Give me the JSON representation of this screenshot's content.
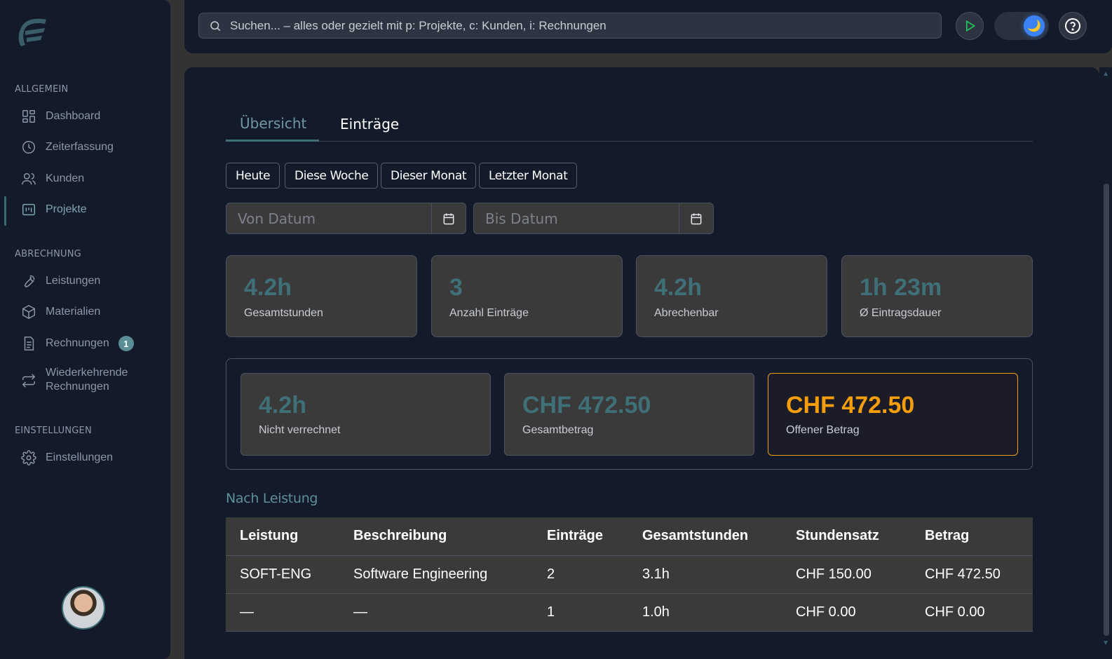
{
  "sidebar": {
    "sections": [
      {
        "title": "ALLGEMEIN"
      },
      {
        "title": "ABRECHNUNG"
      },
      {
        "title": "EINSTELLUNGEN"
      }
    ],
    "items": [
      {
        "label": "Dashboard",
        "icon": "dashboard-icon"
      },
      {
        "label": "Zeiterfassung",
        "icon": "clock-icon"
      },
      {
        "label": "Kunden",
        "icon": "users-icon"
      },
      {
        "label": "Projekte",
        "icon": "project-icon",
        "active": true
      },
      {
        "label": "Leistungen",
        "icon": "wrench-icon"
      },
      {
        "label": "Materialien",
        "icon": "box-icon"
      },
      {
        "label": "Rechnungen",
        "icon": "invoice-icon",
        "badge": "1"
      },
      {
        "label": "Wiederkehrende Rechnungen",
        "icon": "repeat-icon"
      },
      {
        "label": "Einstellungen",
        "icon": "gear-icon"
      }
    ]
  },
  "topbar": {
    "search_placeholder": "Suchen... – alles oder gezielt mit p: Projekte, c: Kunden, i: Rechnungen",
    "theme_icon": "🌙"
  },
  "tabs": [
    {
      "label": "Übersicht",
      "active": true
    },
    {
      "label": "Einträge",
      "active": false
    }
  ],
  "filters": [
    "Heute",
    "Diese Woche",
    "Dieser Monat",
    "Letzter Monat"
  ],
  "date_range": {
    "from_placeholder": "Von Datum",
    "to_placeholder": "Bis Datum"
  },
  "stats": [
    {
      "value": "4.2h",
      "label": "Gesamtstunden"
    },
    {
      "value": "3",
      "label": "Anzahl Einträge"
    },
    {
      "value": "4.2h",
      "label": "Abrechenbar"
    },
    {
      "value": "1h 23m",
      "label": "Ø Eintragsdauer"
    }
  ],
  "money": [
    {
      "value": "4.2h",
      "label": "Nicht verrechnet"
    },
    {
      "value": "CHF 472.50",
      "label": "Gesamtbetrag"
    },
    {
      "value": "CHF 472.50",
      "label": "Offener Betrag"
    }
  ],
  "services": {
    "title": "Nach Leistung",
    "headers": [
      "Leistung",
      "Beschreibung",
      "Einträge",
      "Gesamtstunden",
      "Stundensatz",
      "Betrag"
    ],
    "rows": [
      [
        "SOFT-ENG",
        "Software Engineering",
        "2",
        "3.1h",
        "CHF 150.00",
        "CHF 472.50"
      ],
      [
        "—",
        "—",
        "1",
        "1.0h",
        "CHF 0.00",
        "CHF 0.00"
      ]
    ]
  },
  "colors": {
    "accent": "#3f6f77",
    "highlight": "#f59e0b",
    "background": "#131a2a"
  }
}
